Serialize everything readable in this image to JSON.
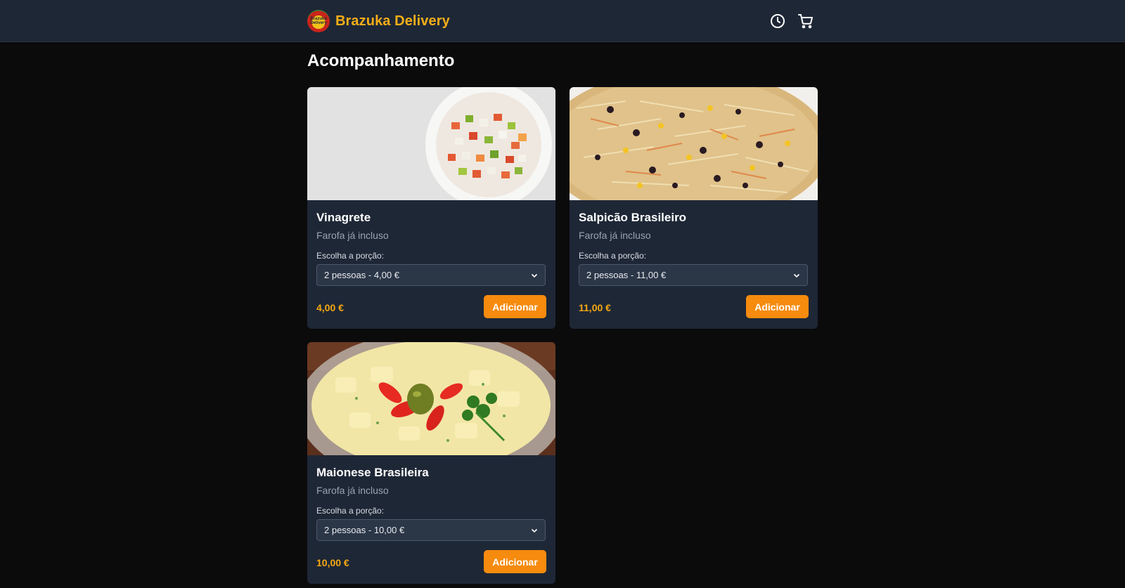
{
  "header": {
    "brand_name": "Brazuka Delivery",
    "logo_text": "Brazuka Delivery",
    "icons": [
      "clock-icon",
      "cart-icon"
    ]
  },
  "page": {
    "title": "Acompanhamento"
  },
  "colors": {
    "accent": "#f68b0e",
    "price": "#f5a811",
    "brand": "#f5ae18",
    "card_bg": "#1e2736"
  },
  "products": [
    {
      "name": "Vinagrete",
      "description": "Farofa já incluso",
      "select_label": "Escolha a porção:",
      "selected_option": "2 pessoas - 4,00 €",
      "price": "4,00 €",
      "button_label": "Adicionar"
    },
    {
      "name": "Salpicão Brasileiro",
      "description": "Farofa já incluso",
      "select_label": "Escolha a porção:",
      "selected_option": "2 pessoas - 11,00 €",
      "price": "11,00 €",
      "button_label": "Adicionar"
    },
    {
      "name": "Maionese Brasileira",
      "description": "Farofa já incluso",
      "select_label": "Escolha a porção:",
      "selected_option": "2 pessoas - 10,00 €",
      "price": "10,00 €",
      "button_label": "Adicionar"
    }
  ]
}
